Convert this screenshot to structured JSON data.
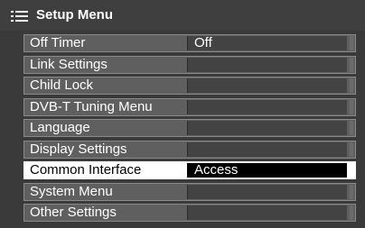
{
  "header": {
    "title": "Setup Menu",
    "icon": "menu-list-icon"
  },
  "colors": {
    "background": "#3a3a3a",
    "row": "#5f5f5f",
    "value_field": "#434343",
    "selected_row": "#ffffff",
    "selected_value_field": "#000000",
    "text": "#ffffff"
  },
  "items": [
    {
      "label": "Off Timer",
      "value": "Off"
    },
    {
      "label": "Link Settings",
      "value": ""
    },
    {
      "label": "Child Lock",
      "value": ""
    },
    {
      "label": "DVB-T Tuning Menu",
      "value": ""
    },
    {
      "label": "Language",
      "value": ""
    },
    {
      "label": "Display Settings",
      "value": ""
    },
    {
      "label": "Common Interface",
      "value": "Access",
      "selected": true
    },
    {
      "label": "System Menu",
      "value": ""
    },
    {
      "label": "Other Settings",
      "value": ""
    }
  ]
}
